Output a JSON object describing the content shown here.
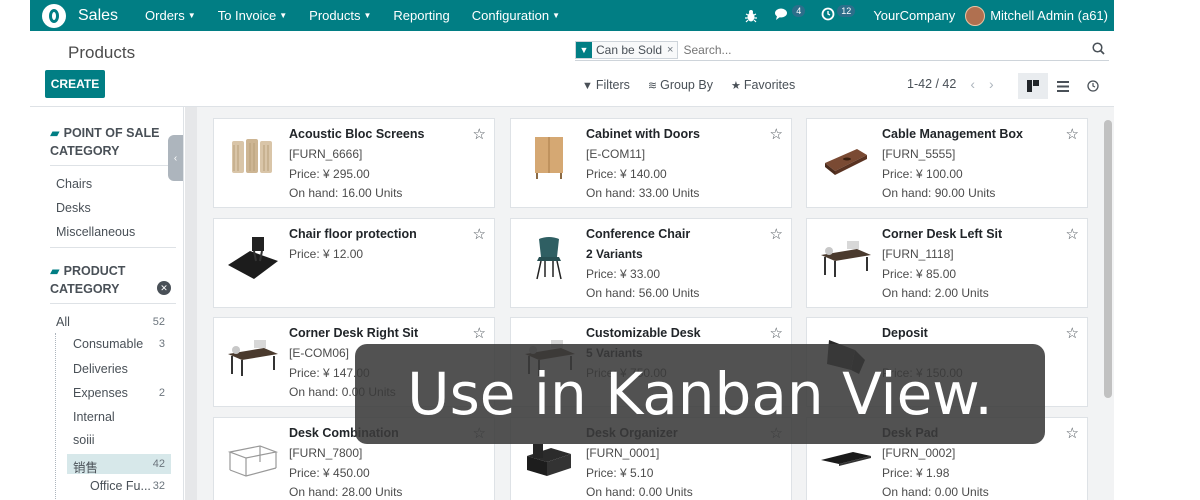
{
  "navbar": {
    "app_name": "Sales",
    "menu": [
      "Orders",
      "To Invoice",
      "Products",
      "Reporting",
      "Configuration"
    ],
    "menu_has_dropdown": [
      true,
      true,
      true,
      false,
      true
    ],
    "messages_count": "4",
    "activities_count": "12",
    "company": "YourCompany",
    "user": "Mitchell Admin (a61)"
  },
  "control": {
    "breadcrumb": "Products",
    "create_label": "CREATE",
    "search_facet": "Can be Sold",
    "search_placeholder": "Search...",
    "filters_label": "Filters",
    "group_by_label": "Group By",
    "favorites_label": "Favorites",
    "pager": "1-42 / 42"
  },
  "sidebar": {
    "pos_category_title_1": "POINT OF SALE",
    "pos_category_title_2": "CATEGORY",
    "pos_categories": [
      "Chairs",
      "Desks",
      "Miscellaneous"
    ],
    "product_category_title_1": "PRODUCT",
    "product_category_title_2": "CATEGORY",
    "all_label": "All",
    "all_count": "52",
    "categories": [
      {
        "label": "Consumable",
        "count": "3"
      },
      {
        "label": "Deliveries",
        "count": ""
      },
      {
        "label": "Expenses",
        "count": "2"
      },
      {
        "label": "Internal",
        "count": ""
      },
      {
        "label": "soiii",
        "count": ""
      },
      {
        "label": "销售",
        "count": "42"
      },
      {
        "label": "Office Fu...",
        "count": "32"
      }
    ]
  },
  "products": [
    {
      "name": "Acoustic Bloc Screens",
      "l1": "[FURN_6666]",
      "l2": "Price: ¥ 295.00",
      "l3": "On hand: 16.00 Units",
      "icon": "acoustic-screen"
    },
    {
      "name": "Cabinet with Doors",
      "l1": "[E-COM11]",
      "l2": "Price: ¥ 140.00",
      "l3": "On hand: 33.00 Units",
      "icon": "cabinet"
    },
    {
      "name": "Cable Management Box",
      "l1": "[FURN_5555]",
      "l2": "Price: ¥ 100.00",
      "l3": "On hand: 90.00 Units",
      "icon": "cable-box"
    },
    {
      "name": "Chair floor protection",
      "l1": "Price: ¥ 12.00",
      "l2": "",
      "l3": "",
      "icon": "floor-mat"
    },
    {
      "name": "Conference Chair",
      "l1": "2 Variants",
      "l2": "Price: ¥ 33.00",
      "l3": "On hand: 56.00 Units",
      "icon": "chair"
    },
    {
      "name": "Corner Desk Left Sit",
      "l1": "[FURN_1118]",
      "l2": "Price: ¥ 85.00",
      "l3": "On hand: 2.00 Units",
      "icon": "desk"
    },
    {
      "name": "Corner Desk Right Sit",
      "l1": "[E-COM06]",
      "l2": "Price: ¥ 147.00",
      "l3": "On hand: 0.00 Units",
      "icon": "desk"
    },
    {
      "name": "Customizable Desk",
      "l1": "5 Variants",
      "l2": "Price: ¥ 750.00",
      "l3": "",
      "icon": "desk"
    },
    {
      "name": "Deposit",
      "l1": "",
      "l2": "Price: ¥ 150.00",
      "l3": "",
      "icon": "deposit"
    },
    {
      "name": "Desk Combination",
      "l1": "[FURN_7800]",
      "l2": "Price: ¥ 450.00",
      "l3": "On hand: 28.00 Units",
      "icon": "desk-wire"
    },
    {
      "name": "Desk Organizer",
      "l1": "[FURN_0001]",
      "l2": "Price: ¥ 5.10",
      "l3": "On hand: 0.00 Units",
      "icon": "organizer"
    },
    {
      "name": "Desk Pad",
      "l1": "[FURN_0002]",
      "l2": "Price: ¥ 1.98",
      "l3": "On hand: 0.00 Units",
      "icon": "desk-pad"
    }
  ],
  "overlay_caption": "Use in Kanban View."
}
